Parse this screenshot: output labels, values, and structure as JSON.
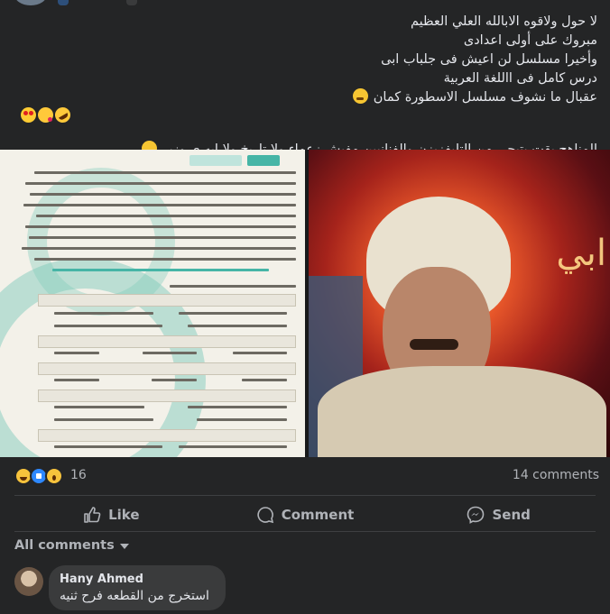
{
  "post": {
    "lines": [
      "لا حول ولاقوه الابالله العلي العظيم",
      "مبروك على أولى اعدادى",
      "وأخيرا مسلسل لن اعيش فى جلباب ابى",
      "درس كامل فى االلغة العربية",
      "عقبال ما نشوف مسلسل الاسطورة كمان"
    ],
    "line2": "المناهج بقت بتيجي من التليفزيزن والفنانيين مفيش زعماء ولا تاريخ  ولا ايه ي وزير"
  },
  "reactions": {
    "count": "16",
    "comments_count": "14 comments"
  },
  "actions": {
    "like": "Like",
    "comment": "Comment",
    "send": "Send"
  },
  "comments": {
    "filter_label": "All comments",
    "items": [
      {
        "author": "Hany Ahmed",
        "text": "استخرج من القطعه فرح ثنيه"
      }
    ]
  }
}
